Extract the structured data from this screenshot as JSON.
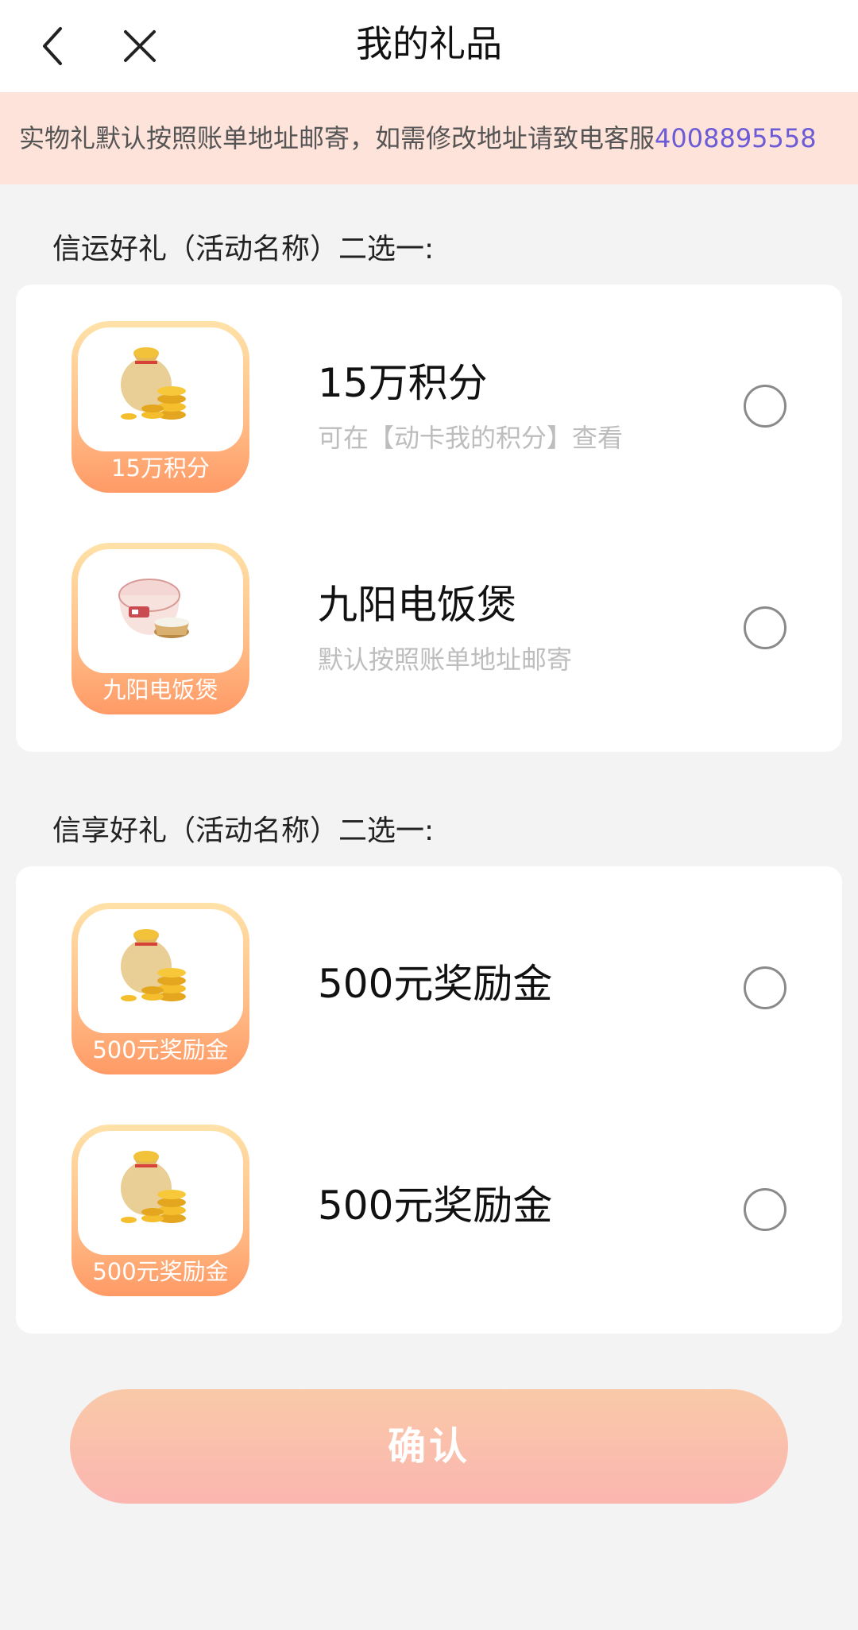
{
  "nav": {
    "title": "我的礼品",
    "back_icon": "chevron-left-icon",
    "close_icon": "close-icon"
  },
  "notice": {
    "text": "实物礼默认按照账单地址邮寄，如需修改地址请致电客服",
    "phone": "4008895558"
  },
  "groups": [
    {
      "title": "信运好礼（活动名称）二选一:",
      "items": [
        {
          "thumb_caption": "15万积分",
          "name": "15万积分",
          "sub": "可在【动卡我的积分】查看",
          "icon": "money-bag-icon"
        },
        {
          "thumb_caption": "九阳电饭煲",
          "name": "九阳电饭煲",
          "sub": "默认按照账单地址邮寄",
          "icon": "rice-cooker-icon"
        }
      ]
    },
    {
      "title": "信享好礼（活动名称）二选一:",
      "items": [
        {
          "thumb_caption": "500元奖励金",
          "name": "500元奖励金",
          "icon": "money-bag-icon"
        },
        {
          "thumb_caption": "500元奖励金",
          "name": "500元奖励金",
          "icon": "money-bag-icon"
        }
      ]
    }
  ],
  "confirm_label": "确认",
  "colors": {
    "notice_bg": "#fde3da",
    "phone": "#6b5bd6",
    "button_top": "#f9c9a8",
    "button_bottom": "#fbb6b0"
  }
}
